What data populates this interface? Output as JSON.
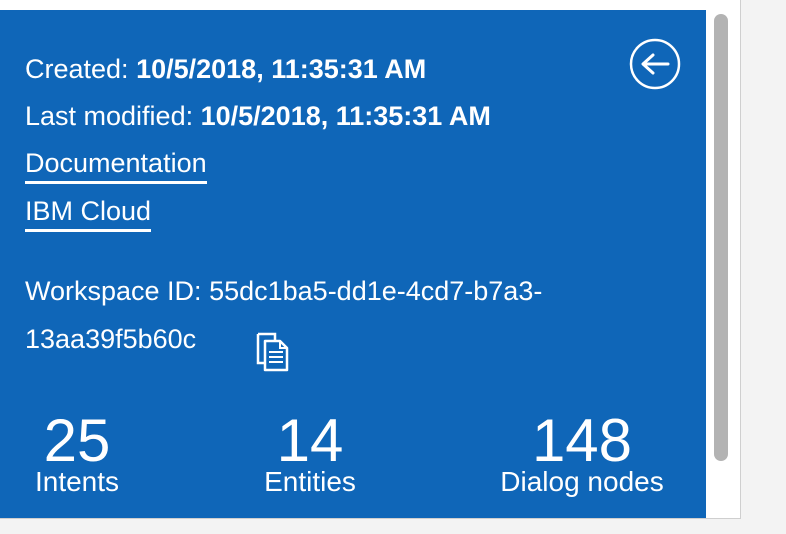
{
  "workspace": {
    "created_label": "Created:",
    "created_value": "10/5/2018, 11:35:31 AM",
    "modified_label": "Last modified:",
    "modified_value": "10/5/2018, 11:35:31 AM",
    "links": {
      "documentation": "Documentation",
      "ibm_cloud": "IBM Cloud"
    },
    "id_label": "Workspace ID:",
    "id_value_line1": "55dc1ba5-dd1e-4cd7-b7a3-",
    "id_value_line2": "13aa39f5b60c"
  },
  "stats": [
    {
      "value": "25",
      "label": "Intents"
    },
    {
      "value": "14",
      "label": "Entities"
    },
    {
      "value": "148",
      "label": "Dialog nodes"
    }
  ],
  "icons": {
    "back": "arrow-left-circle-icon",
    "copy": "copy-icon"
  },
  "colors": {
    "panel_bg": "#0f66b8",
    "text": "#ffffff",
    "scrollbar_thumb": "#b3b3b3"
  }
}
